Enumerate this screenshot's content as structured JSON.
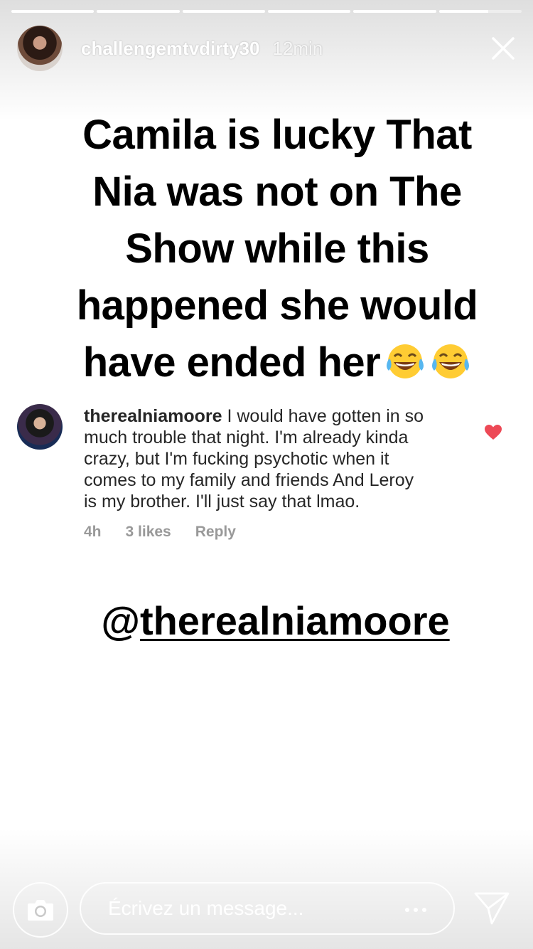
{
  "story": {
    "progress_segments": [
      1,
      1,
      1,
      1,
      1,
      0.6
    ],
    "username": "challengemtvdirty30",
    "time": "12min",
    "caption_lines": [
      "Camila is lucky That",
      "Nia was not on The",
      "Show while this",
      "happened she would",
      "have ended her"
    ],
    "caption_emoji": "face-with-tears-of-joy x2"
  },
  "comment": {
    "username": "therealniamoore",
    "lines": [
      "I would have gotten in so",
      "much trouble that night. I'm already kinda",
      "crazy, but I'm fucking psychotic when it",
      "comes to my family and friends And Leroy",
      "is my brother. I'll just say that lmao."
    ],
    "meta": {
      "age": "4h",
      "likes": "3 likes",
      "reply": "Reply"
    },
    "heart_color": "#ed4956"
  },
  "mention": {
    "at": "@",
    "handle": "therealniamoore"
  },
  "footer": {
    "message_placeholder": "Écrivez un message..."
  }
}
